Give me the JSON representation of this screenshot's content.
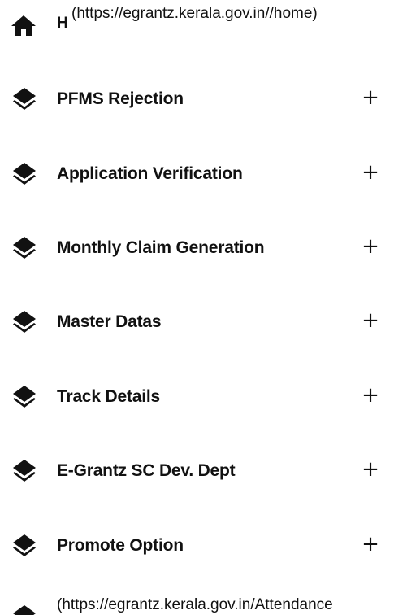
{
  "home": {
    "label": "H",
    "url_text": "(https://egrantz.kerala.gov.in//home)",
    "icon": "home-icon"
  },
  "menu_items": [
    {
      "label": "PFMS Rejection",
      "expand": "+",
      "icon": "layers-icon"
    },
    {
      "label": "Application Verification",
      "expand": "+",
      "icon": "layers-icon"
    },
    {
      "label": "Monthly Claim Generation",
      "expand": "+",
      "icon": "layers-icon"
    },
    {
      "label": "Master Datas",
      "expand": "+",
      "icon": "layers-icon"
    },
    {
      "label": "Track Details",
      "expand": "+",
      "icon": "layers-icon"
    },
    {
      "label": "E-Grantz SC Dev. Dept",
      "expand": "+",
      "icon": "layers-icon"
    },
    {
      "label": "Promote Option",
      "expand": "+",
      "icon": "layers-icon"
    }
  ],
  "bottom": {
    "url_text": "(https://egrantz.kerala.gov.in/Attendance"
  },
  "colors": {
    "text": "#111111",
    "background": "#ffffff"
  }
}
